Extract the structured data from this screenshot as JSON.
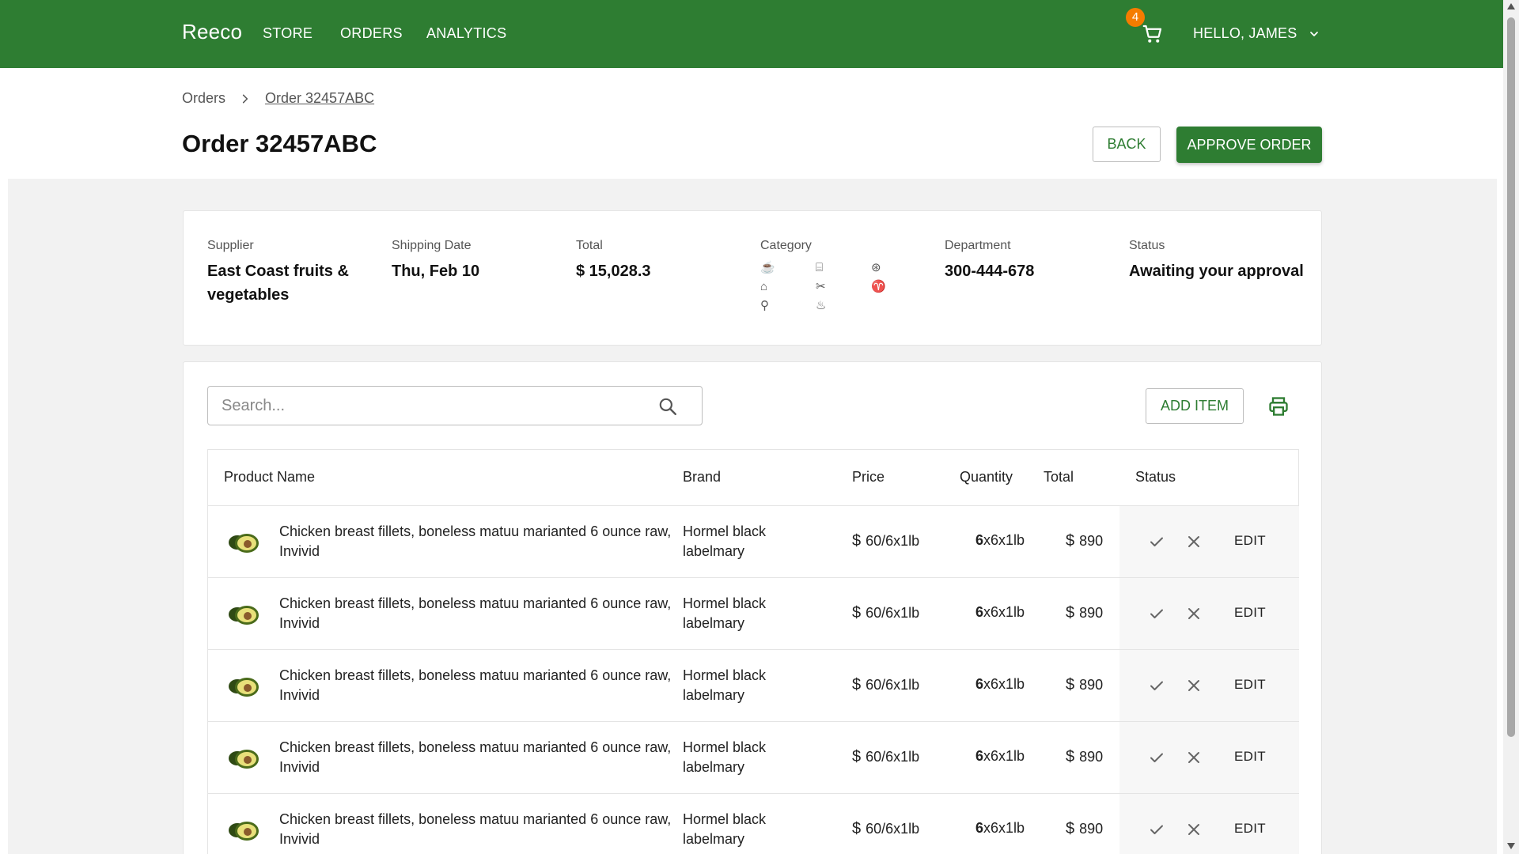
{
  "topbar": {
    "brand": "Reeco",
    "nav": [
      "STORE",
      "ORDERS",
      "ANALYTICS"
    ],
    "cart_count": "4",
    "greeting": "HELLO, JAMES",
    "color": "#2e7d32",
    "badge_color": "#f57c00"
  },
  "breadcrumb": {
    "root": "Orders",
    "current": "Order 32457ABC"
  },
  "page": {
    "title": "Order 32457ABC",
    "back_label": "BACK",
    "approve_label": "APPROVE ORDER"
  },
  "summary": {
    "supplier_label": "Supplier",
    "supplier_value": "East Coast fruits & vegetables",
    "shipping_label": "Shipping Date",
    "shipping_value": "Thu, Feb 10",
    "total_label": "Total",
    "total_value": "$ 15,028.3",
    "category_label": "Category",
    "category_icons": [
      "coffee-icon",
      "kitchen-icon",
      "citrus-icon",
      "bakery-icon",
      "utensils-icon",
      "drinks-icon",
      "cutlery-icon",
      "bottles-icon"
    ],
    "department_label": "Department",
    "department_value": "300-444-678",
    "status_label": "Status",
    "status_value": "Awaiting your approval"
  },
  "items": {
    "search_placeholder": "Search...",
    "add_label": "ADD ITEM",
    "columns": [
      "Product Name",
      "Brand",
      "Price",
      "Quantity",
      "Total",
      "Status"
    ],
    "rows": [
      {
        "name": "Chicken breast fillets, boneless matuu marianted 6 ounce raw, Invivid",
        "brand": "Hormel black labelmary",
        "price": "60/6x1lb",
        "qty_bold": "6",
        "qty_rest": "x6x1lb",
        "total": "890",
        "edit": "EDIT"
      },
      {
        "name": "Chicken breast fillets, boneless matuu marianted 6 ounce raw, Invivid",
        "brand": "Hormel black labelmary",
        "price": "60/6x1lb",
        "qty_bold": "6",
        "qty_rest": "x6x1lb",
        "total": "890",
        "edit": "EDIT"
      },
      {
        "name": "Chicken breast fillets, boneless matuu marianted 6 ounce raw, Invivid",
        "brand": "Hormel black labelmary",
        "price": "60/6x1lb",
        "qty_bold": "6",
        "qty_rest": "x6x1lb",
        "total": "890",
        "edit": "EDIT"
      },
      {
        "name": "Chicken breast fillets, boneless matuu marianted 6 ounce raw, Invivid",
        "brand": "Hormel black labelmary",
        "price": "60/6x1lb",
        "qty_bold": "6",
        "qty_rest": "x6x1lb",
        "total": "890",
        "edit": "EDIT"
      },
      {
        "name": "Chicken breast fillets, boneless matuu marianted 6 ounce raw, Invivid",
        "brand": "Hormel black labelmary",
        "price": "60/6x1lb",
        "qty_bold": "6",
        "qty_rest": "x6x1lb",
        "total": "890",
        "edit": "EDIT"
      }
    ]
  }
}
